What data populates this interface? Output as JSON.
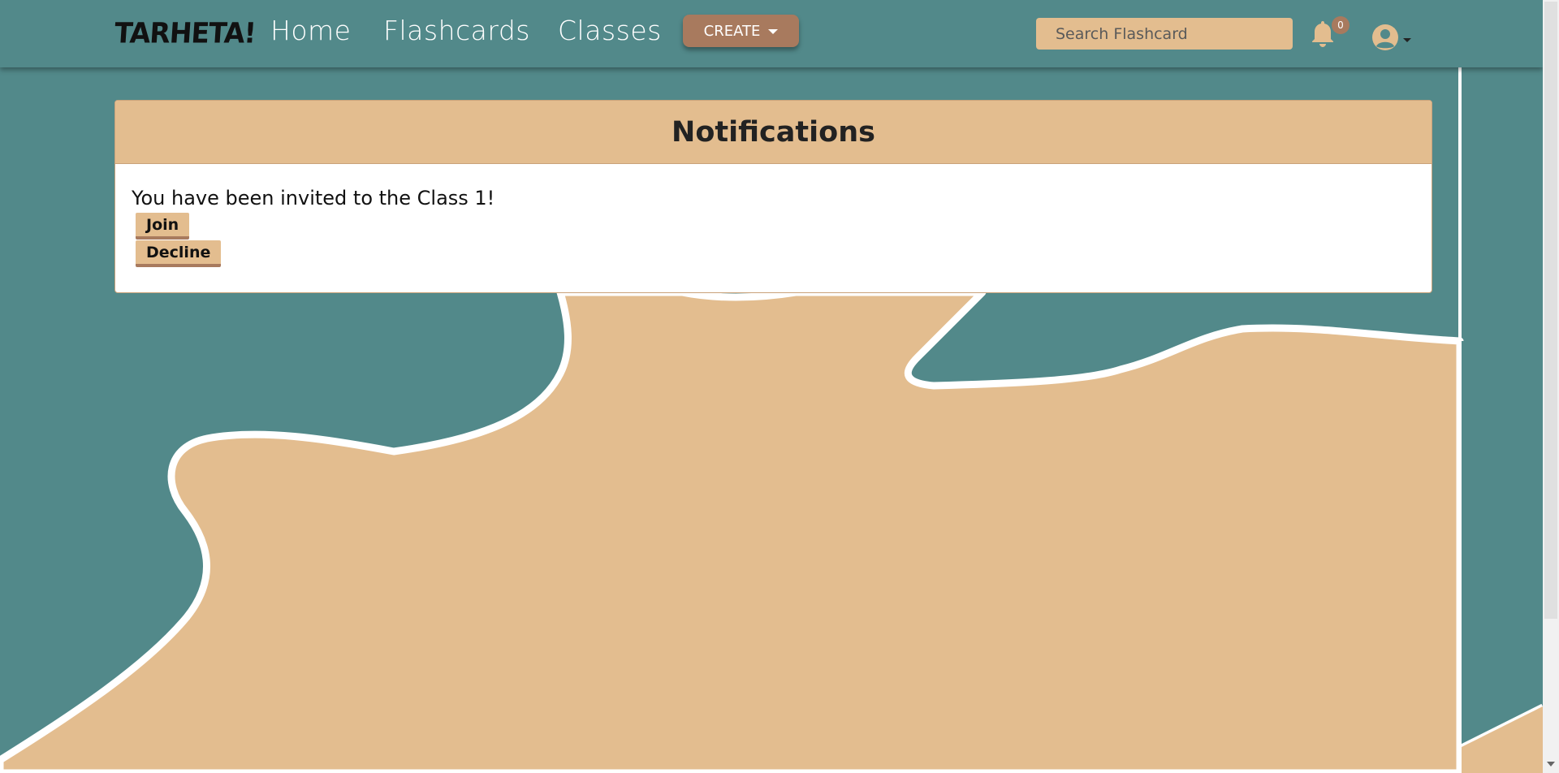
{
  "colors": {
    "teal": "#52898a",
    "tan": "#e3bd8f",
    "brown": "#a87a5e",
    "white": "#ffffff"
  },
  "navbar": {
    "logo": "TARHETA!",
    "links": [
      "Home",
      "Flashcards",
      "Classes"
    ],
    "create_label": "CREATE",
    "search_placeholder": "Search Flashcard",
    "notification_count": "0",
    "icons": {
      "bell": "bell-icon",
      "user": "user-circle-icon",
      "caret": "caret-down-icon"
    }
  },
  "notifications": {
    "title": "Notifications",
    "items": [
      {
        "message": "You have been invited to the Class 1!",
        "join_label": "Join",
        "decline_label": "Decline"
      }
    ]
  }
}
